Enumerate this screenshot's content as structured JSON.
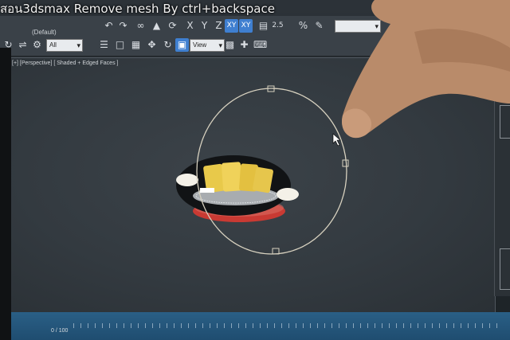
{
  "video_title": "สอน3dsmax Remove mesh By ctrl+backspace",
  "toolbar": {
    "workspace": "(Default)",
    "filter_select": "All",
    "reference_select": "View",
    "axis_x": "X",
    "axis_y": "Y",
    "axis_z": "Z",
    "axis_xy": "XY",
    "axis_xy2": "XY",
    "snap_label": "2.5",
    "percent_label": "%"
  },
  "viewport": {
    "label": "[+] [Perspective] [ Shaded + Edged Faces ]"
  },
  "timeline": {
    "frame_counter": "0 / 100"
  },
  "colors": {
    "viewport_bg": "#3a4147",
    "active_axis": "#3f7fd0",
    "gizmo": "#d8d2c0",
    "cushion": "#e8c94a",
    "base": "#c93a33"
  }
}
